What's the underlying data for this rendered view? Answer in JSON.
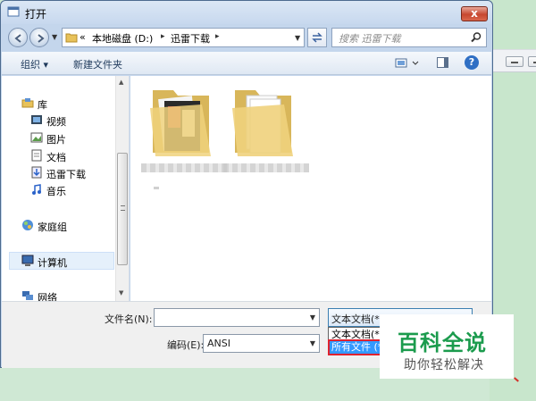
{
  "window": {
    "title": "打开",
    "close_label": "x"
  },
  "address": {
    "prefix": "«",
    "crumbs": [
      "本地磁盘 (D:)",
      "迅雷下载"
    ],
    "separator": "▸"
  },
  "search": {
    "placeholder": "搜索 迅雷下载"
  },
  "toolbar": {
    "organize": "组织 ▾",
    "new_folder": "新建文件夹",
    "help": "?"
  },
  "nav": {
    "items": [
      {
        "label": "库",
        "icon": "library-icon"
      },
      {
        "label": "视频",
        "icon": "video-icon"
      },
      {
        "label": "图片",
        "icon": "picture-icon"
      },
      {
        "label": "文档",
        "icon": "document-icon"
      },
      {
        "label": "迅雷下载",
        "icon": "download-icon"
      },
      {
        "label": "音乐",
        "icon": "music-icon"
      },
      {
        "label": "家庭组",
        "icon": "homegroup-icon"
      },
      {
        "label": "计算机",
        "icon": "computer-icon"
      },
      {
        "label": "网络",
        "icon": "network-icon"
      }
    ]
  },
  "files": [
    {
      "icon": "folder-with-images-icon"
    },
    {
      "icon": "folder-with-documents-icon"
    }
  ],
  "bottom": {
    "filename_label": "文件名(N):",
    "filename_value": "",
    "encoding_label": "编码(E):",
    "encoding_value": "ANSI",
    "filetype_selected": "文本文档(*.t",
    "filetype_options": [
      "文本文档(*.t",
      "所有文件 (*"
    ]
  },
  "watermark": {
    "title": "百科全说",
    "subtitle": "助你轻松解决"
  },
  "colors": {
    "accent": "#3399ff",
    "highlight_border": "#e0222e",
    "brand_green": "#1b9b4d"
  }
}
